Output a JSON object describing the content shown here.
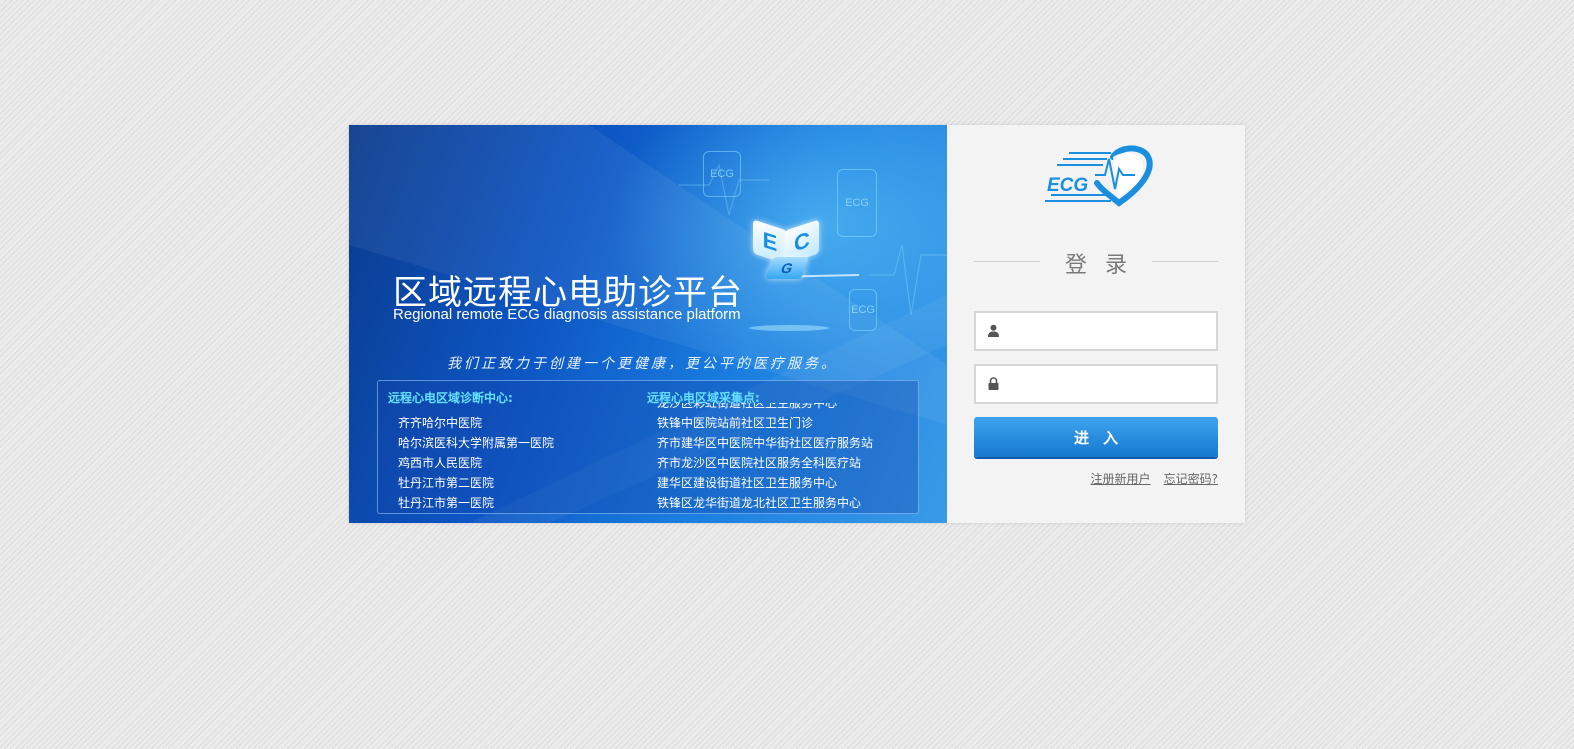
{
  "banner": {
    "title": "区域远程心电助诊平台",
    "subtitle": "Regional remote ECG diagnosis assistance platform",
    "slogan": "我们正致力于创建一个更健康，更公平的医疗服务。",
    "cube_letters": [
      "E",
      "C",
      "G"
    ],
    "float_icon_label": "ECG"
  },
  "centers": {
    "diagnosis_title": "远程心电区域诊断中心:",
    "diagnosis_list": [
      "齐齐哈尔中医院",
      "哈尔滨医科大学附属第一医院",
      "鸡西市人民医院",
      "牡丹江市第二医院",
      "牡丹江市第一医院"
    ],
    "collection_title": "远程心电区域采集点:",
    "collection_list": [
      "龙沙区彩虹街道社区卫生服务中心",
      "铁锋中医院站前社区卫生门诊",
      "齐市建华区中医院中华街社区医疗服务站",
      "齐市龙沙区中医院社区服务全科医疗站",
      "建华区建设街道社区卫生服务中心",
      "铁锋区龙华街道龙北社区卫生服务中心"
    ]
  },
  "login": {
    "logo_text": "ECG",
    "title": "登录",
    "username": {
      "value": "",
      "placeholder": ""
    },
    "password": {
      "value": "",
      "placeholder": ""
    },
    "submit_label": "进入",
    "register_link": "注册新用户",
    "forgot_link": "忘记密码?"
  },
  "colors": {
    "brand_blue": "#1a8fe0",
    "button_top": "#3ea3ee",
    "button_bottom": "#1679cf",
    "panel_bg": "#f3f3f3",
    "accent_cyan": "#66e0ff"
  }
}
